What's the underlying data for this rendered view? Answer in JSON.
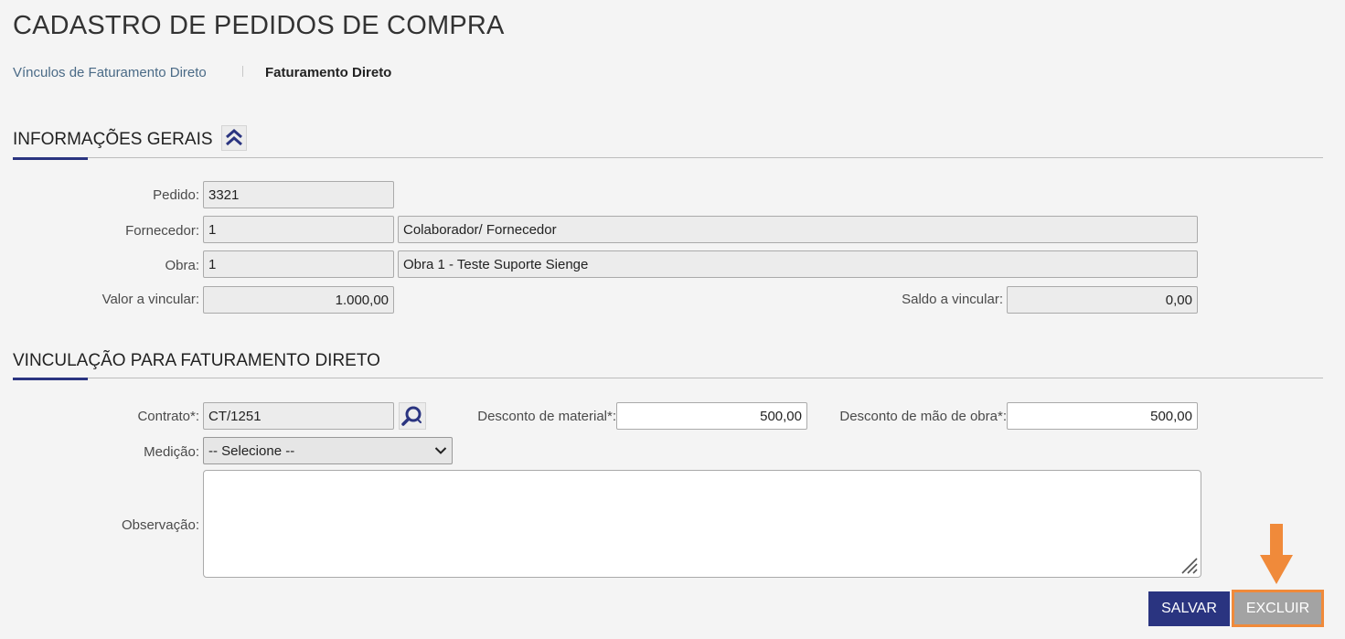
{
  "page": {
    "title": "CADASTRO DE PEDIDOS DE COMPRA"
  },
  "tabs": [
    {
      "label": "Vínculos de Faturamento Direto",
      "active": false
    },
    {
      "label": "Faturamento Direto",
      "active": true
    }
  ],
  "section_general": {
    "title": "INFORMAÇÕES GERAIS",
    "collapse_icon": "double-chevron-up-icon",
    "pedido": {
      "label": "Pedido:",
      "value": "3321"
    },
    "fornecedor": {
      "label": "Fornecedor:",
      "code": "1",
      "name": "Colaborador/ Fornecedor"
    },
    "obra": {
      "label": "Obra:",
      "code": "1",
      "name": "Obra 1 - Teste Suporte Sienge"
    },
    "valor_vincular": {
      "label": "Valor a vincular:",
      "value": "1.000,00"
    },
    "saldo_vincular": {
      "label": "Saldo a vincular:",
      "value": "0,00"
    }
  },
  "section_link": {
    "title": "VINCULAÇÃO PARA FATURAMENTO DIRETO",
    "contrato": {
      "label": "Contrato*:",
      "value": "CT/1251",
      "search_icon": "search-icon"
    },
    "desconto_material": {
      "label": "Desconto de material*:",
      "value": "500,00"
    },
    "desconto_mao_obra": {
      "label": "Desconto de mão de obra*:",
      "value": "500,00"
    },
    "medicao": {
      "label": "Medição:",
      "selected": "-- Selecione --"
    },
    "observacao": {
      "label": "Observação:",
      "value": ""
    }
  },
  "actions": {
    "save_label": "SALVAR",
    "delete_label": "EXCLUIR"
  },
  "colors": {
    "primary": "#2a3480",
    "highlight": "#f08a3a",
    "disabled_button": "#a3a3a3",
    "link": "#4a6a86"
  }
}
